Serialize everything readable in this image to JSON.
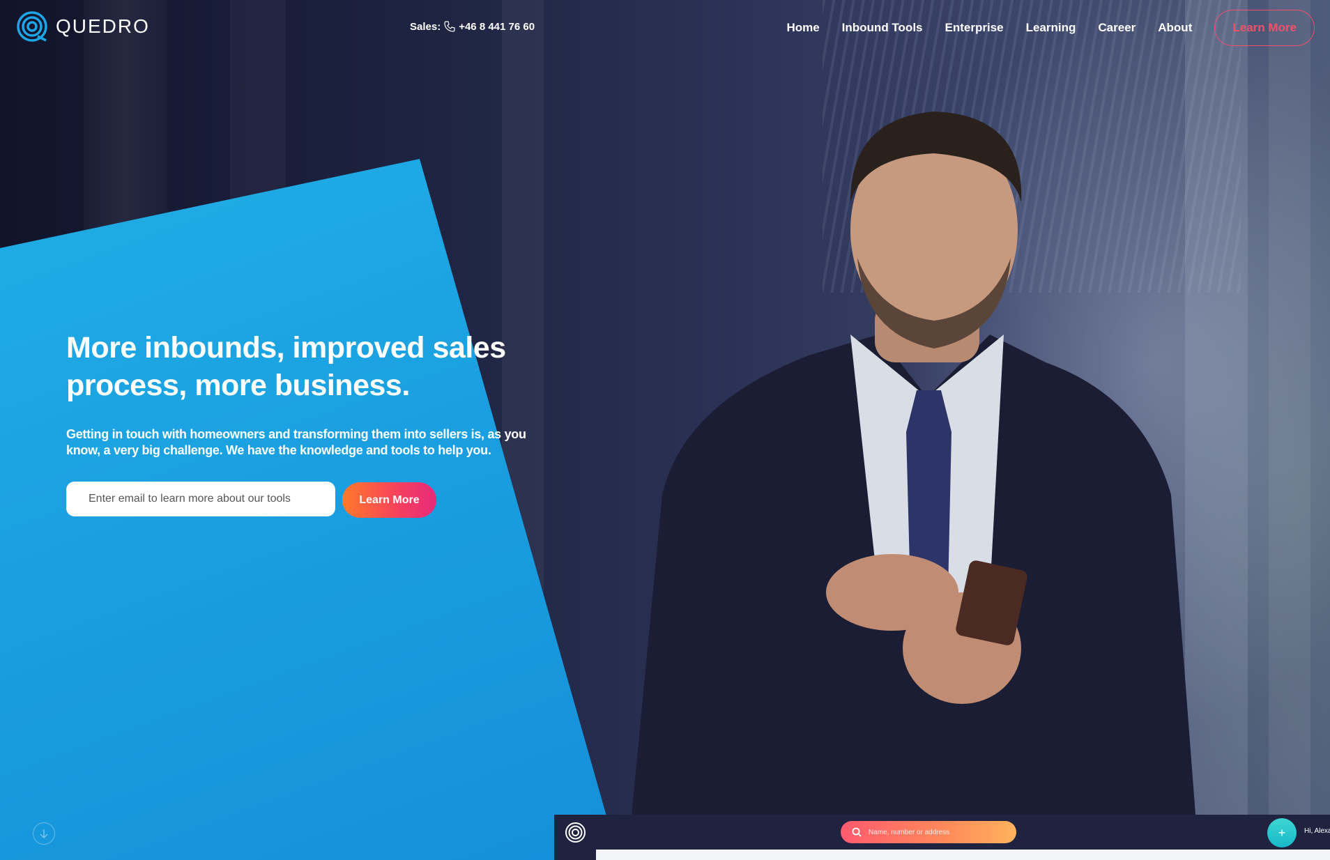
{
  "brand": {
    "name": "QUEDRO"
  },
  "header": {
    "sales_label": "Sales:",
    "sales_phone": "+46 8 441 76 60",
    "nav": [
      "Home",
      "Inbound Tools",
      "Enterprise",
      "Learning",
      "Career",
      "About"
    ],
    "cta_label": "Learn More"
  },
  "hero": {
    "headline": "More inbounds, improved sales process, more business.",
    "subtext": "Getting in touch with homeowners and transforming them into sellers is, as you know, a very big challenge. We have the knowledge and tools to help you.",
    "email_placeholder": "Enter email to learn more about our tools",
    "cta_label": "Learn More"
  },
  "app_preview": {
    "search_placeholder": "Name, number or address",
    "add_label": "+",
    "greeting": "Hi, Alexa"
  },
  "colors": {
    "accent": "#f25168",
    "hero_blue": "#1a9fe0",
    "app_bar": "#1f2340"
  },
  "icons": [
    "quedro-logo-icon",
    "phone-icon",
    "arrow-down-icon",
    "search-icon",
    "plus-icon"
  ]
}
